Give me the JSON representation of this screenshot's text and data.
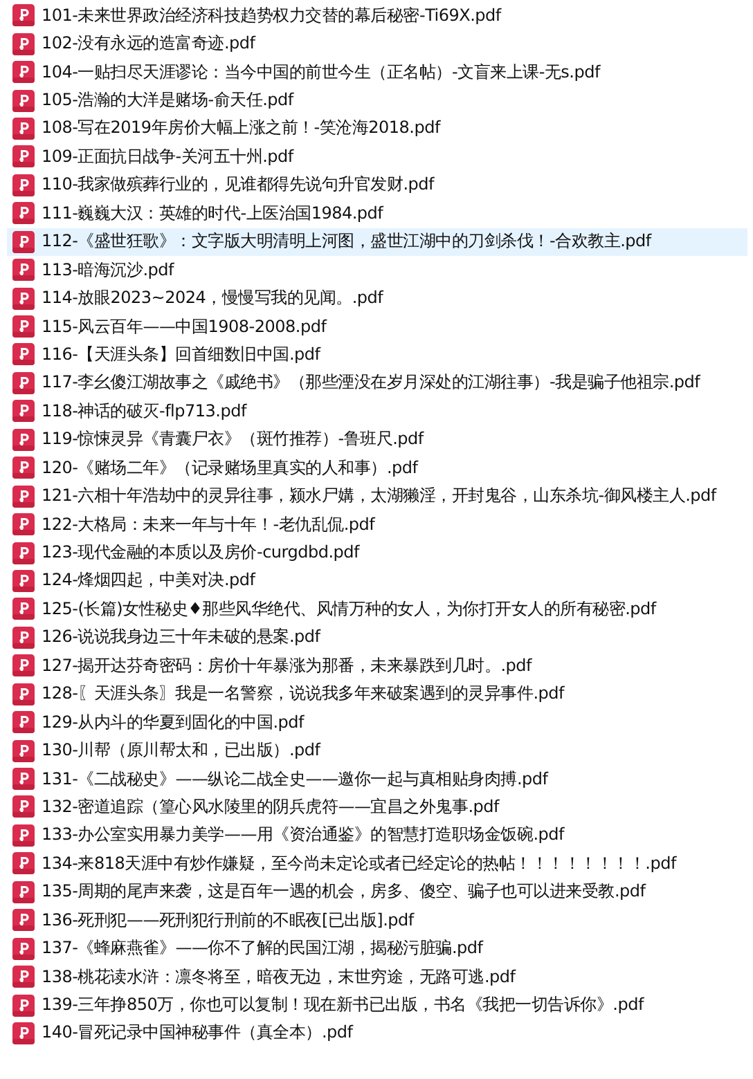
{
  "files": [
    {
      "name": "101-未来世界政治经济科技趋势权力交替的幕后秘密-Ti69X.pdf",
      "selected": false
    },
    {
      "name": "102-没有永远的造富奇迹.pdf",
      "selected": false
    },
    {
      "name": "104-一贴扫尽天涯谬论：当今中国的前世今生（正名帖）-文盲来上课-无s.pdf",
      "selected": false
    },
    {
      "name": "105-浩瀚的大洋是赌场-俞天任.pdf",
      "selected": false
    },
    {
      "name": "108-写在2019年房价大幅上涨之前！-笑沧海2018.pdf",
      "selected": false
    },
    {
      "name": "109-正面抗日战争-关河五十州.pdf",
      "selected": false
    },
    {
      "name": "110-我家做殡葬行业的，见谁都得先说句升官发财.pdf",
      "selected": false
    },
    {
      "name": "111-巍巍大汉：英雄的时代-上医治国1984.pdf",
      "selected": false
    },
    {
      "name": "112-《盛世狂歌》：文字版大明清明上河图，盛世江湖中的刀剑杀伐！-合欢教主.pdf",
      "selected": true
    },
    {
      "name": "113-暗海沉沙.pdf",
      "selected": false
    },
    {
      "name": "114-放眼2023~2024，慢慢写我的见闻。.pdf",
      "selected": false
    },
    {
      "name": "115-风云百年——中国1908-2008.pdf",
      "selected": false
    },
    {
      "name": "116-【天涯头条】回首细数旧中国.pdf",
      "selected": false
    },
    {
      "name": "117-李幺傻江湖故事之《戚绝书》（那些湮没在岁月深处的江湖往事）-我是骗子他祖宗.pdf",
      "selected": false
    },
    {
      "name": "118-神话的破灭-flp713.pdf",
      "selected": false
    },
    {
      "name": "119-惊悚灵异《青囊尸衣》（斑竹推荐）-鲁班尺.pdf",
      "selected": false
    },
    {
      "name": "120-《赌场二年》（记录赌场里真实的人和事）.pdf",
      "selected": false
    },
    {
      "name": "121-六相十年浩劫中的灵异往事，颍水尸媾，太湖獭淫，开封鬼谷，山东杀坑-御风楼主人.pdf",
      "selected": false
    },
    {
      "name": "122-大格局：未来一年与十年！-老仇乱侃.pdf",
      "selected": false
    },
    {
      "name": "123-现代金融的本质以及房价-curgdbd.pdf",
      "selected": false
    },
    {
      "name": "124-烽烟四起，中美对决.pdf",
      "selected": false
    },
    {
      "name": "125-(长篇)女性秘史♦那些风华绝代、风情万种的女人，为你打开女人的所有秘密.pdf",
      "selected": false
    },
    {
      "name": "126-说说我身边三十年未破的悬案.pdf",
      "selected": false
    },
    {
      "name": "127-揭开达芬奇密码：房价十年暴涨为那番，未来暴跌到几时。.pdf",
      "selected": false
    },
    {
      "name": "128-〖天涯头条〗我是一名警察，说说我多年来破案遇到的灵异事件.pdf",
      "selected": false
    },
    {
      "name": "129-从内斗的华夏到固化的中国.pdf",
      "selected": false
    },
    {
      "name": "130-川帮（原川帮太和，已出版）.pdf",
      "selected": false
    },
    {
      "name": "131-《二战秘史》——纵论二战全史——邀你一起与真相贴身肉搏.pdf",
      "selected": false
    },
    {
      "name": "132-密道追踪（篁心风水陵里的阴兵虎符——宜昌之外鬼事.pdf",
      "selected": false
    },
    {
      "name": "133-办公室实用暴力美学——用《资治通鉴》的智慧打造职场金饭碗.pdf",
      "selected": false
    },
    {
      "name": "134-来818天涯中有炒作嫌疑，至今尚未定论或者已经定论的热帖！！！！！！！！.pdf",
      "selected": false
    },
    {
      "name": "135-周期的尾声来袭，这是百年一遇的机会，房多、傻空、骗子也可以进来受教.pdf",
      "selected": false
    },
    {
      "name": "136-死刑犯——死刑犯行刑前的不眠夜[已出版].pdf",
      "selected": false
    },
    {
      "name": "137-《蜂麻燕雀》——你不了解的民国江湖，揭秘污脏骗.pdf",
      "selected": false
    },
    {
      "name": "138-桃花读水浒：凛冬将至，暗夜无边，末世穷途，无路可逃.pdf",
      "selected": false
    },
    {
      "name": "139-三年挣850万，你也可以复制！现在新书已出版，书名《我把一切告诉你》.pdf",
      "selected": false
    },
    {
      "name": "140-冒死记录中国神秘事件（真全本）.pdf",
      "selected": false
    }
  ]
}
